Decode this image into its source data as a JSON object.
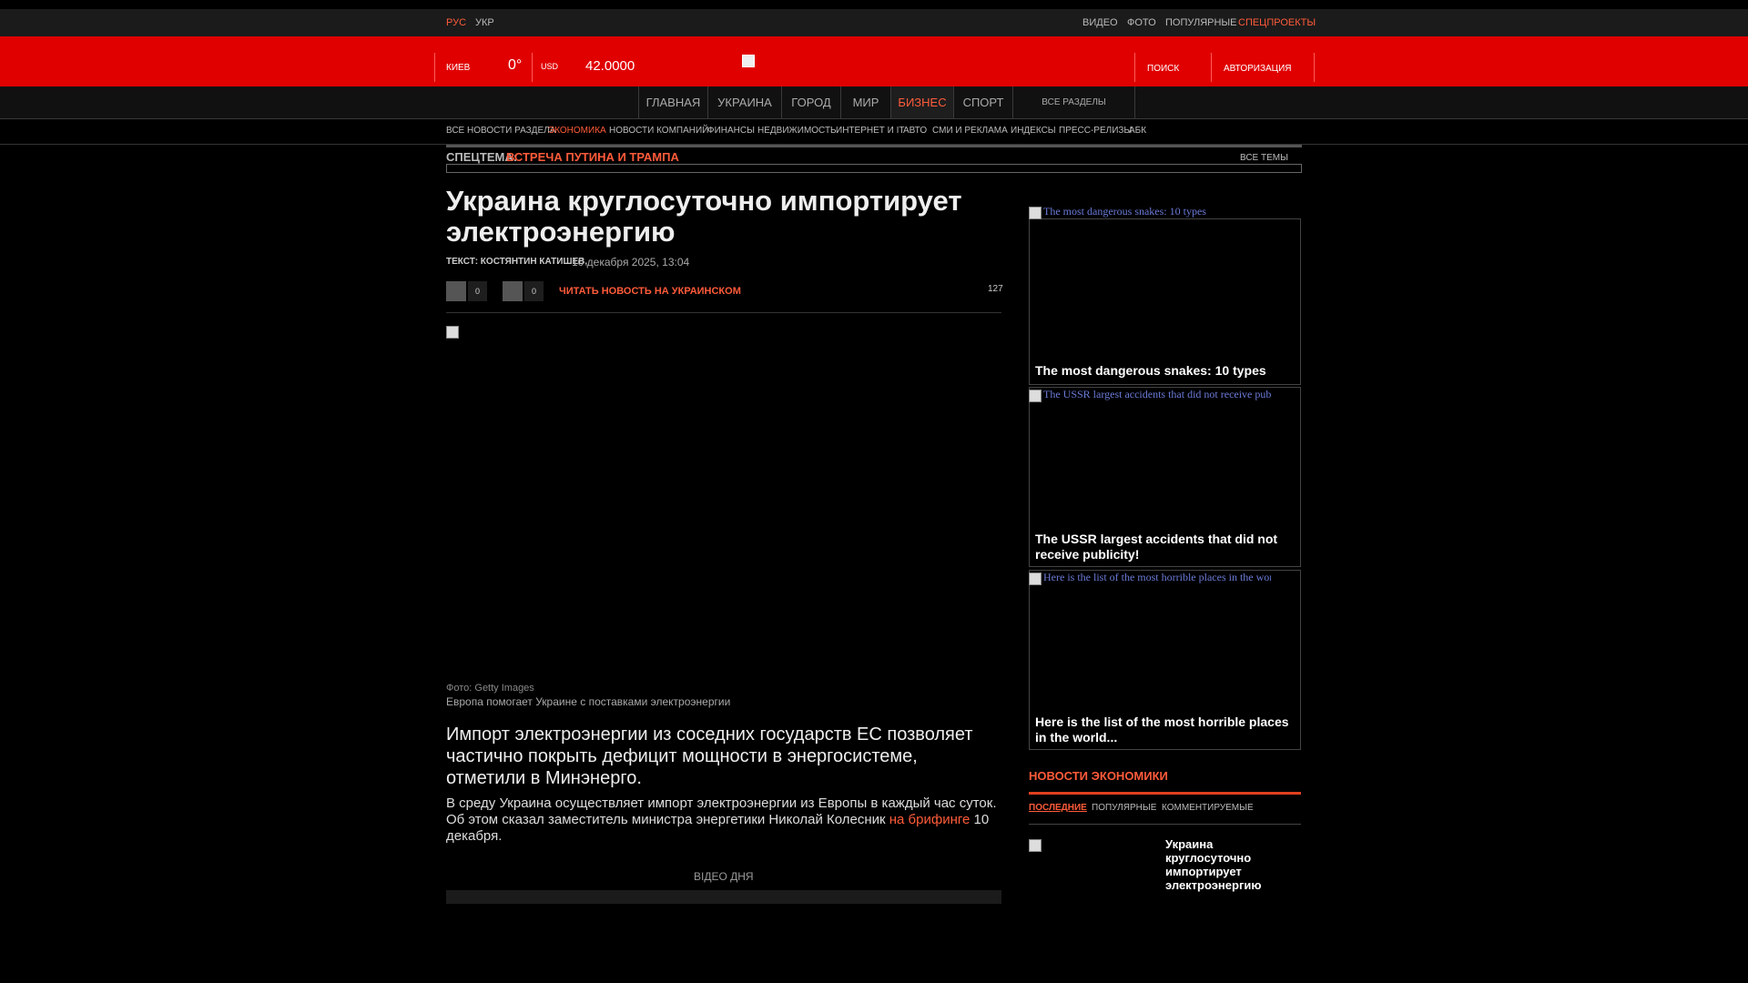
{
  "topbar": {
    "lang_ru": "РУС",
    "lang_ua": "УКР",
    "links": [
      "ВИДЕО",
      "ФОТО",
      "ПОПУЛЯРНЫЕ"
    ],
    "special": "СПЕЦПРОЕКТЫ"
  },
  "redbar": {
    "city": "КИЕВ",
    "temp": "0°",
    "currency": "USD",
    "rate": "42.0000",
    "search": "ПОИСК",
    "auth": "АВТОРИЗАЦИЯ"
  },
  "nav": {
    "items": [
      "ГЛАВНАЯ",
      "УКРАИНА",
      "ГОРОД",
      "МИР",
      "БИЗНЕС",
      "СПОРТ"
    ],
    "all_sections": "ВСЕ РАЗДЕЛЫ"
  },
  "subnav": [
    "ВСЕ НОВОСТИ РАЗДЕЛА",
    "ЭКОНОМИКА",
    "НОВОСТИ КОМПАНИЙ",
    "ФИНАНСЫ",
    "НЕДВИЖИМОСТЬ",
    "ИНТЕРНЕТ И IT",
    "АВТО",
    "СМИ И РЕКЛАМА",
    "ИНДЕКСЫ",
    "ПРЕСС-РЕЛИЗЫ",
    "АБК"
  ],
  "special_topic": {
    "label": "СПЕЦТЕМА:",
    "topic": "ВСТРЕЧА ПУТИНА И ТРАМПА",
    "all_topics": "ВСЕ ТЕМЫ"
  },
  "article": {
    "title": "Украина круглосуточно импортирует электроэнергию",
    "author": "ТЕКСТ: КОСТЯНТИН КАТИШЕВ,",
    "date": "10 декабря 2025, 13:04",
    "fb_count": "0",
    "tw_count": "0",
    "read_ua": "ЧИТАТЬ НОВОСТЬ НА УКРАИНСКОМ",
    "views": "127",
    "photo_credit": "Фото: Getty Images",
    "photo_caption": "Европа помогает Украине с поставками электроэнергии",
    "lead": "Импорт электроэнергии из соседних государств ЕС позволяет частично покрыть дефицит мощности в энергосистеме, отметили в Минэнерго.",
    "body_pre": "В среду Украина осуществляет импорт электроэнергии из Европы в каждый час суток. Об этом сказал заместитель министра энергетики Николай Колесник ",
    "body_link": "на брифинге",
    "body_post": " 10 декабря.",
    "video_label": "ВІДЕО ДНЯ"
  },
  "promo": [
    {
      "alt": "The most dangerous snakes: 10 types",
      "caption": "The most dangerous snakes: 10 types"
    },
    {
      "alt": "The USSR largest accidents that did not receive publicity!",
      "caption": "The USSR largest accidents that did not receive publicity!"
    },
    {
      "alt": "Here is the list of the most horrible places in the world...",
      "caption": "Here is the list of the most horrible places in the world..."
    }
  ],
  "econ": {
    "heading": "НОВОСТИ ЭКОНОМИКИ",
    "tabs": [
      "ПОСЛЕДНИЕ",
      "ПОПУЛЯРНЫЕ",
      "КОММЕНТИРУЕМЫЕ"
    ],
    "item_title": "Украина круглосуточно импортирует электроэнергию"
  },
  "colors": {
    "brand_red": "#e00000",
    "accent": "#ff5b3a",
    "background": "#000000"
  }
}
